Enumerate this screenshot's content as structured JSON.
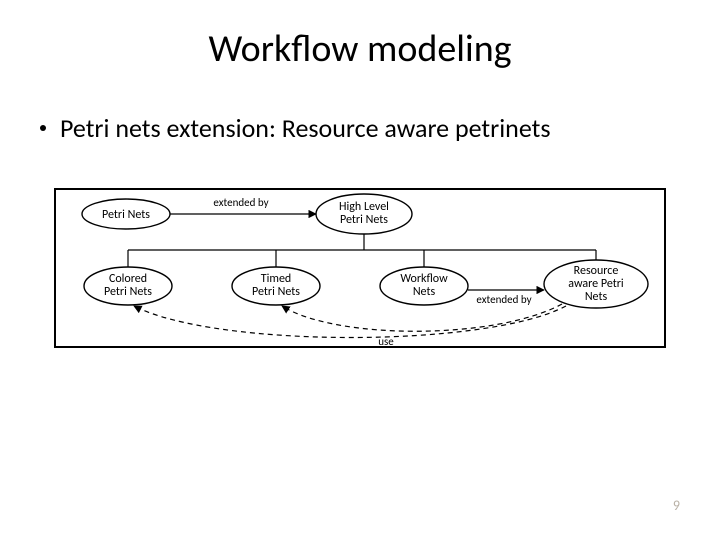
{
  "title": "Workflow modeling",
  "bullet": "Petri nets extension: Resource aware petrinets",
  "diagram": {
    "nodes": {
      "petri": {
        "line1": "Petri Nets"
      },
      "high": {
        "line1": "High Level",
        "line2": "Petri Nets"
      },
      "colored": {
        "line1": "Colored",
        "line2": "Petri Nets"
      },
      "timed": {
        "line1": "Timed",
        "line2": "Petri Nets"
      },
      "workflow": {
        "line1": "Workflow",
        "line2": "Nets"
      },
      "resource": {
        "line1": "Resource",
        "line2": "aware Petri",
        "line3": "Nets"
      }
    },
    "labels": {
      "extended1": "extended by",
      "extended2": "extended by",
      "use": "use"
    }
  },
  "page_number": "9"
}
